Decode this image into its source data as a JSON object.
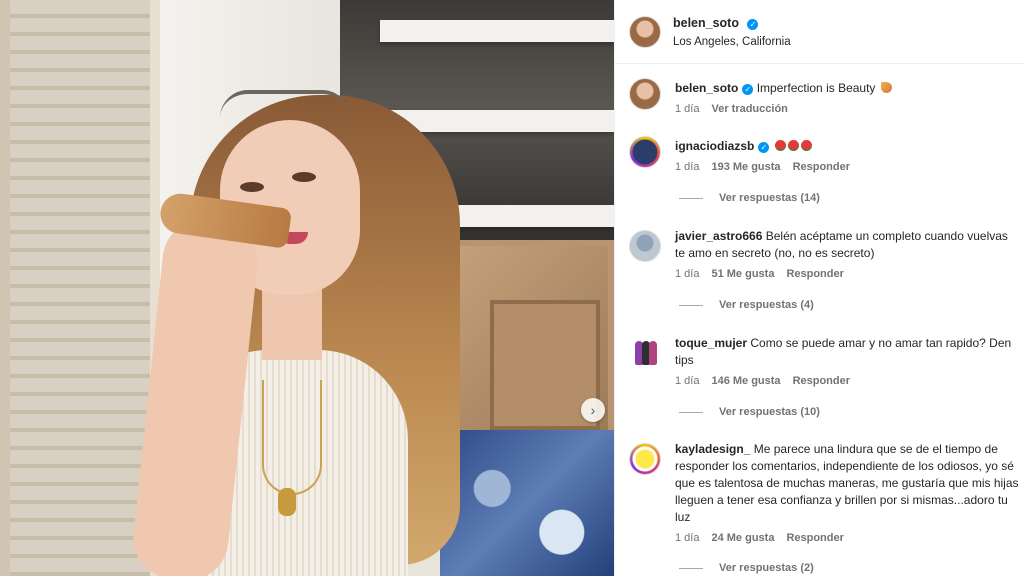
{
  "post": {
    "username": "belen_soto",
    "location": "Los Angeles, California",
    "caption_user": "belen_soto",
    "caption_text": "Imperfection is Beauty",
    "caption_time": "1 día",
    "translate_label": "Ver traducción"
  },
  "photo": {
    "next_label": "›"
  },
  "comments": [
    {
      "user": "ignaciodiazsb",
      "verified": true,
      "text": "",
      "time": "1 día",
      "likes": "193 Me gusta",
      "reply": "Responder",
      "view_replies": "Ver respuestas (14)"
    },
    {
      "user": "javier_astro666",
      "verified": false,
      "text": "Belén acéptame un completo cuando vuelvas te amo en secreto (no, no es secreto)",
      "time": "1 día",
      "likes": "51 Me gusta",
      "reply": "Responder",
      "view_replies": "Ver respuestas (4)"
    },
    {
      "user": "toque_mujer",
      "verified": false,
      "text": "Como se puede amar y no amar tan rapido? Den tips",
      "time": "1 día",
      "likes": "146 Me gusta",
      "reply": "Responder",
      "view_replies": "Ver respuestas (10)"
    },
    {
      "user": "kayladesign_",
      "verified": false,
      "text": "Me parece una lindura que se de el tiempo de responder los comentarios, independiente de los odiosos, yo sé que es talentosa de muchas maneras, me gustaría que mis hijas lleguen a tener esa confianza y brillen por si mismas...adoro tu luz",
      "time": "1 día",
      "likes": "24 Me gusta",
      "reply": "Responder",
      "view_replies": "Ver respuestas (2)"
    }
  ],
  "icons": {
    "verified": "verified-badge-icon",
    "roses": "rose-emoji-icon",
    "pizza": "pizza-emoji-icon",
    "next": "chevron-right-icon"
  },
  "colors": {
    "verified": "#0095f6",
    "text": "#262626",
    "muted": "#737373"
  }
}
